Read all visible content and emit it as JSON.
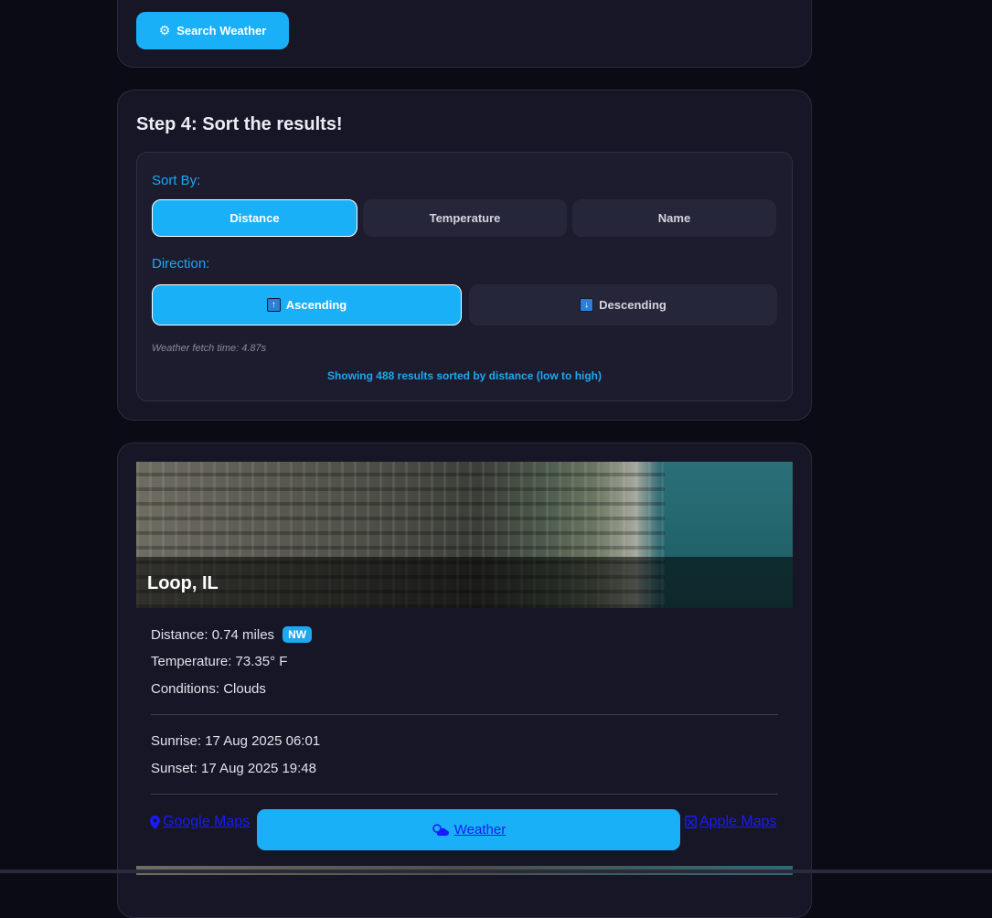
{
  "search": {
    "button_label": "Search Weather",
    "icon": "gear-icon"
  },
  "sort_section": {
    "title": "Step 4: Sort the results!",
    "sort_by_label": "Sort By:",
    "sort_options": [
      "Distance",
      "Temperature",
      "Name"
    ],
    "selected_sort": "Distance",
    "direction_label": "Direction:",
    "direction_options": [
      {
        "label": "Ascending",
        "icon": "up-arrow-icon",
        "glyph": "↑"
      },
      {
        "label": "Descending",
        "icon": "down-arrow-icon",
        "glyph": "↓"
      }
    ],
    "selected_direction": "Ascending",
    "fetch_time": "Weather fetch time: 4.87s",
    "summary": "Showing 488 results sorted by distance (low to high)"
  },
  "result": {
    "location": "Loop, IL",
    "distance": "Distance: 0.74 miles",
    "direction_badge": "NW",
    "temperature": "Temperature: 73.35° F",
    "conditions": "Conditions: Clouds",
    "sunrise": "Sunrise: 17 Aug 2025 06:01",
    "sunset": "Sunset: 17 Aug 2025 19:48",
    "links": {
      "google": "Google Maps",
      "weather": "Weather",
      "apple": "Apple Maps"
    }
  },
  "colors": {
    "accent": "#1ab0f7",
    "label_blue": "#1ea8f0",
    "card_bg": "#161627",
    "page_bg": "#0b0b16",
    "link": "#1a1aff"
  }
}
